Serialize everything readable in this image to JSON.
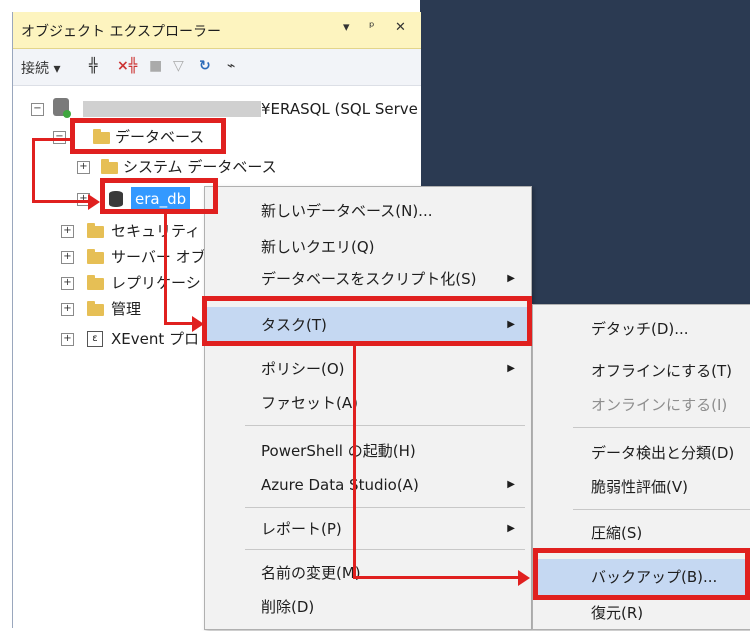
{
  "explorer": {
    "title": "オブジェクト エクスプローラー",
    "title_buttons": [
      "▾",
      "ᵖ",
      "✕"
    ],
    "connect_label": "接続",
    "server_label": "¥ERASQL (SQL Serve",
    "tree": {
      "databases": "データベース",
      "system_databases": "システム データベース",
      "era_db": "era_db",
      "security": "セキュリティ",
      "server_objects": "サーバー オブ",
      "replication": "レプリケーシ",
      "management": "管理",
      "xevent": "XEvent プロ"
    }
  },
  "context_menu": {
    "items": [
      {
        "label": "新しいデータベース(N)...",
        "submenu": false
      },
      {
        "label": "新しいクエリ(Q)",
        "submenu": false
      },
      {
        "label": "データベースをスクリプト化(S)",
        "submenu": true
      },
      {
        "label": "タスク(T)",
        "submenu": true,
        "highlighted": true
      },
      {
        "label": "ポリシー(O)",
        "submenu": true
      },
      {
        "label": "ファセット(A)",
        "submenu": false
      },
      {
        "label": "PowerShell の起動(H)",
        "submenu": false
      },
      {
        "label": "Azure Data Studio(A)",
        "submenu": true
      },
      {
        "label": "レポート(P)",
        "submenu": true
      },
      {
        "label": "名前の変更(M)",
        "submenu": false
      },
      {
        "label": "削除(D)",
        "submenu": false
      }
    ]
  },
  "submenu": {
    "items": [
      {
        "label": "デタッチ(D)...",
        "disabled": false
      },
      {
        "label": "オフラインにする(T)",
        "disabled": false
      },
      {
        "label": "オンラインにする(I)",
        "disabled": true
      },
      {
        "label": "データ検出と分類(D)",
        "disabled": false
      },
      {
        "label": "脆弱性評価(V)",
        "disabled": false
      },
      {
        "label": "圧縮(S)",
        "disabled": false
      },
      {
        "label": "バックアップ(B)...",
        "disabled": false,
        "highlighted": true
      },
      {
        "label": "復元(R)",
        "disabled": false
      }
    ]
  },
  "colors": {
    "annotation_red": "#e0201f",
    "selection_blue": "#3399ff",
    "menu_highlight": "#c5d8f2",
    "dark_background": "#2b3a52",
    "title_bar": "#fdf4bf"
  }
}
